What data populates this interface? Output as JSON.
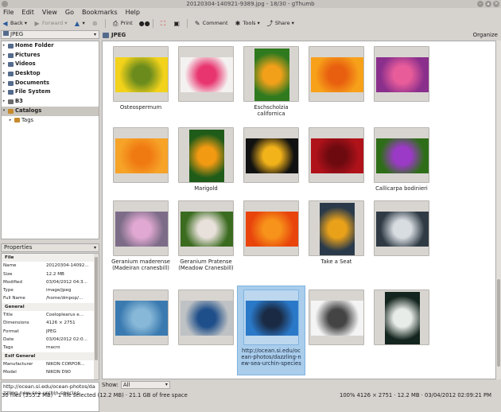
{
  "window": {
    "title": "20120304-140921-9389.jpg - 18/30 - gThumb"
  },
  "menu": [
    "File",
    "Edit",
    "View",
    "Go",
    "Bookmarks",
    "Help"
  ],
  "toolbar": {
    "back": "Back",
    "forward": "Forward",
    "print": "Print",
    "comment": "Comment",
    "tools": "Tools",
    "share": "Share"
  },
  "left": {
    "location": "JPEG",
    "tree": [
      {
        "label": "Home Folder",
        "selected": false
      },
      {
        "label": "Pictures",
        "selected": false
      },
      {
        "label": "Videos",
        "selected": false
      },
      {
        "label": "Desktop",
        "selected": false
      },
      {
        "label": "Documents",
        "selected": false
      },
      {
        "label": "File System",
        "selected": false
      },
      {
        "label": "B3",
        "selected": false
      },
      {
        "label": "Catalogs",
        "selected": true
      },
      {
        "label": "Tags",
        "selected": false
      }
    ],
    "properties_title": "Properties",
    "properties": [
      {
        "k": "File",
        "v": "",
        "section": true
      },
      {
        "k": "Name",
        "v": "20120304-14092..."
      },
      {
        "k": "Size",
        "v": "12.2 MB"
      },
      {
        "k": "Modified",
        "v": "03/04/2012 04:3..."
      },
      {
        "k": "Type",
        "v": "image/jpeg"
      },
      {
        "k": "Full Name",
        "v": "/home/dmpop/..."
      },
      {
        "k": "General",
        "v": "",
        "section": true
      },
      {
        "k": "Title",
        "v": "Coeloplearus e..."
      },
      {
        "k": "Dimensions",
        "v": "4126 × 2751"
      },
      {
        "k": "Format",
        "v": "JPEG"
      },
      {
        "k": "Date",
        "v": "03/04/2012 02:0..."
      },
      {
        "k": "Tags",
        "v": "macro"
      },
      {
        "k": "Exif General",
        "v": "",
        "section": true
      },
      {
        "k": "Manufacturer",
        "v": "NIKON CORPOR..."
      },
      {
        "k": "Model",
        "v": "NIKON D90"
      }
    ],
    "comment": "http://ocean.si.edu/ocean-photos/dazzling-new-sea-urchin-species"
  },
  "main": {
    "folder": "JPEG",
    "organize": "Organize",
    "show_label": "Show:",
    "show_value": "All"
  },
  "thumbs": [
    {
      "caption": "Osteospermum",
      "colors": [
        "#f2d21a",
        "#6b8c1d"
      ]
    },
    {
      "caption": "",
      "colors": [
        "#f4f2f0",
        "#e8356f"
      ]
    },
    {
      "caption": "Eschscholzia californica",
      "colors": [
        "#2f7a1f",
        "#f2a01a"
      ]
    },
    {
      "caption": "",
      "colors": [
        "#f7a11a",
        "#e8600f"
      ]
    },
    {
      "caption": "",
      "colors": [
        "#8a2f8c",
        "#e85c9a"
      ]
    },
    {
      "caption": "",
      "colors": [
        "#f6a328",
        "#f07a12"
      ]
    },
    {
      "caption": "Marigold",
      "colors": [
        "#1f5c19",
        "#f29a12"
      ]
    },
    {
      "caption": "",
      "colors": [
        "#111111",
        "#f2b21a"
      ]
    },
    {
      "caption": "",
      "colors": [
        "#b0121a",
        "#6d0a10"
      ]
    },
    {
      "caption": "Callicarpa bodinieri",
      "colors": [
        "#2f6e18",
        "#9b3ac6"
      ]
    },
    {
      "caption": "Geranium maderense (Madeiran cranesbill)",
      "colors": [
        "#7c6c88",
        "#e0a8d2"
      ]
    },
    {
      "caption": "Geranium Pratense (Meadow Cranesbill)",
      "colors": [
        "#3a6b1f",
        "#e8e0da"
      ]
    },
    {
      "caption": "",
      "colors": [
        "#e8440c",
        "#f7921a"
      ]
    },
    {
      "caption": "Take a Seat",
      "colors": [
        "#2a3a4a",
        "#e9a11a"
      ]
    },
    {
      "caption": "",
      "colors": [
        "#2f3a44",
        "#d8dde2"
      ]
    },
    {
      "caption": "",
      "colors": [
        "#3a7ab0",
        "#88b8d8"
      ]
    },
    {
      "caption": "",
      "colors": [
        "#bfc2c4",
        "#1f4f8a"
      ]
    },
    {
      "caption": "http://ocean.si.edu/ocean-photos/dazzling-new-sea-urchin-species",
      "colors": [
        "#2a78c8",
        "#1a2a44"
      ],
      "selected": true
    },
    {
      "caption": "",
      "colors": [
        "#f4f4f4",
        "#444444"
      ]
    },
    {
      "caption": "",
      "colors": [
        "#14241e",
        "#e8ece8"
      ]
    }
  ],
  "status": {
    "left": "30 files (355.2 MB) · 1 file selected (12.2 MB) · 21.1 GB of free space",
    "right": "100%   4126 × 2751 · 12.2 MB · 03/04/2012 02:09:21 PM"
  }
}
